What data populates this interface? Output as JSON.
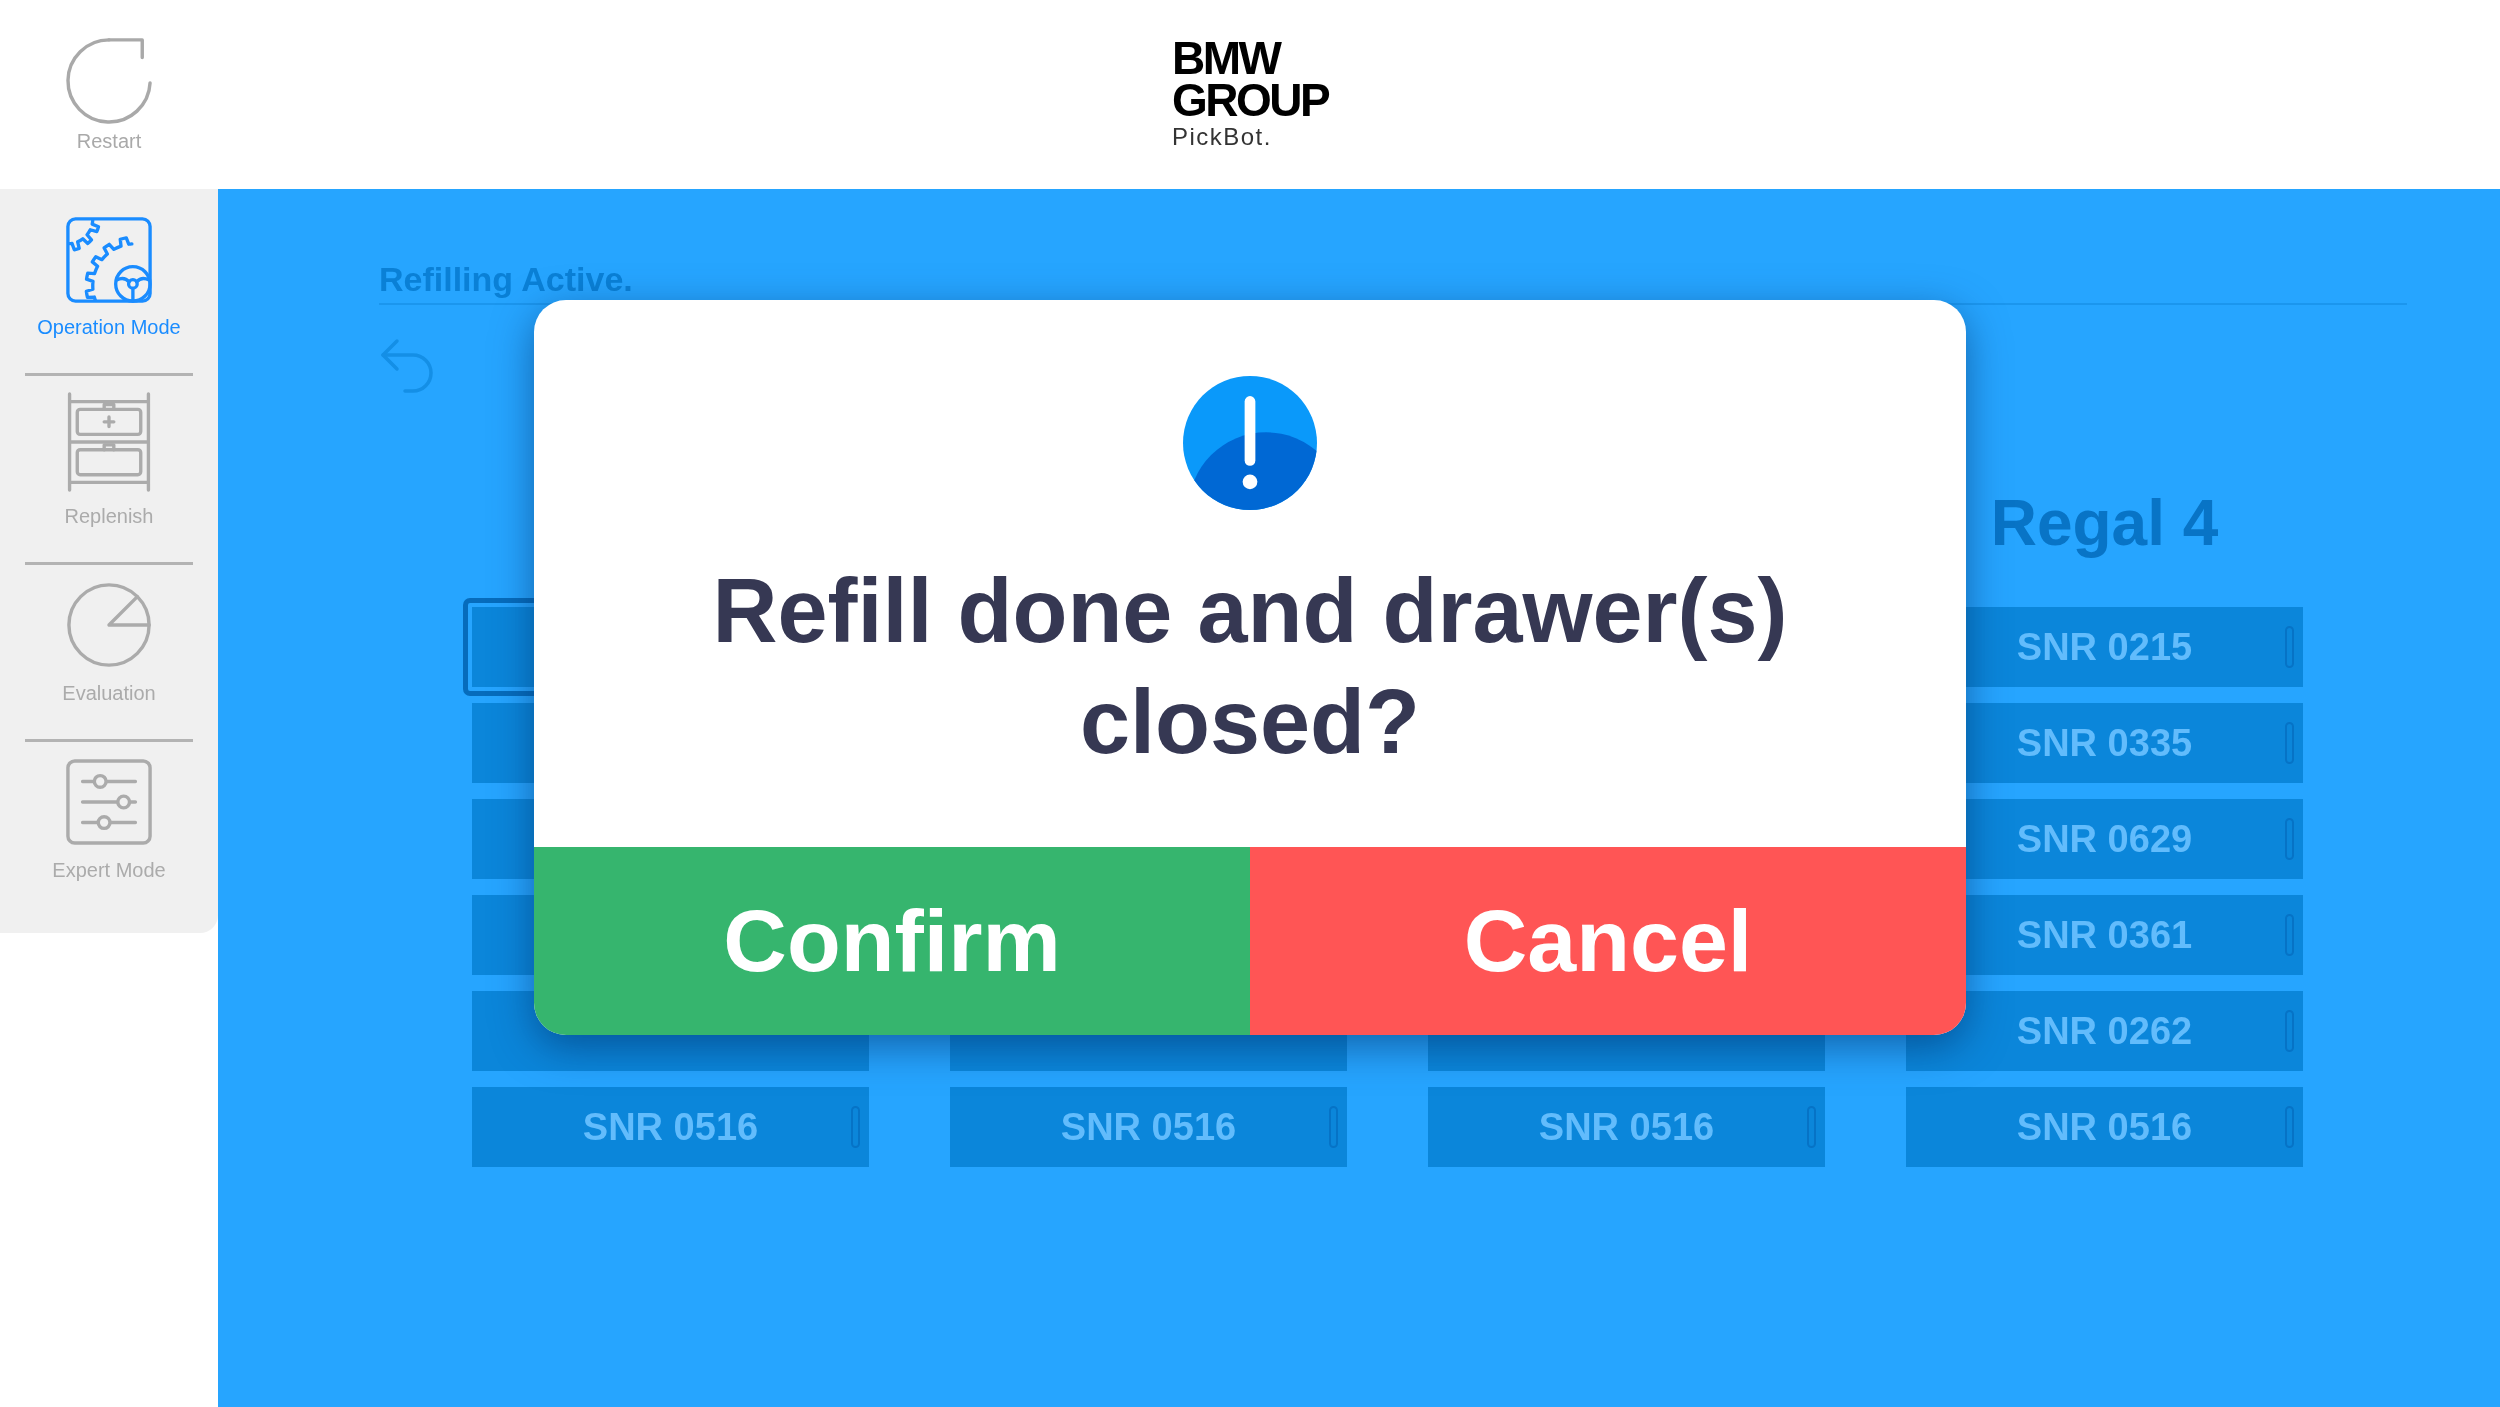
{
  "header": {
    "restart": {
      "label": "Restart"
    },
    "logo": {
      "lines": [
        "BMW",
        "GROUP"
      ],
      "tagline": "PickBot."
    }
  },
  "sidebar": {
    "items": [
      {
        "kind": "operation",
        "label": "Operation Mode",
        "selected": true
      },
      {
        "kind": "replenish",
        "label": "Replenish",
        "selected": false
      },
      {
        "kind": "evaluation",
        "label": "Evaluation",
        "selected": false
      },
      {
        "kind": "expert",
        "label": "Expert Mode",
        "selected": false
      }
    ]
  },
  "main": {
    "title": "Refilling Active.",
    "columns": [
      {
        "cells": [
          {
            "selected": true
          },
          {
            "selected": false
          },
          {
            "selected": false
          },
          {
            "selected": false
          },
          {
            "selected": false
          },
          {
            "label": "SNR 0516",
            "selected": false
          }
        ]
      },
      {
        "cells": [
          {
            "selected": false
          },
          {
            "label": "SNR 0516",
            "selected": false
          }
        ]
      },
      {
        "cells": [
          {
            "selected": false
          },
          {
            "label": "SNR 0516",
            "selected": false
          }
        ]
      },
      {
        "heading": "Regal 4",
        "cells": [
          {
            "label": "SNR 0215",
            "selected": false
          },
          {
            "label": "SNR 0335",
            "selected": false
          },
          {
            "label": "SNR 0629",
            "selected": false
          },
          {
            "label": "SNR 0361",
            "selected": false
          },
          {
            "label": "SNR 0262",
            "selected": false
          },
          {
            "label": "SNR 0516",
            "selected": false
          }
        ]
      }
    ]
  },
  "dialog": {
    "message": "Refill done and drawer(s) closed?",
    "buttons": [
      {
        "kind": "confirm",
        "label": "Confirm"
      },
      {
        "kind": "cancel",
        "label": "Cancel"
      }
    ]
  }
}
